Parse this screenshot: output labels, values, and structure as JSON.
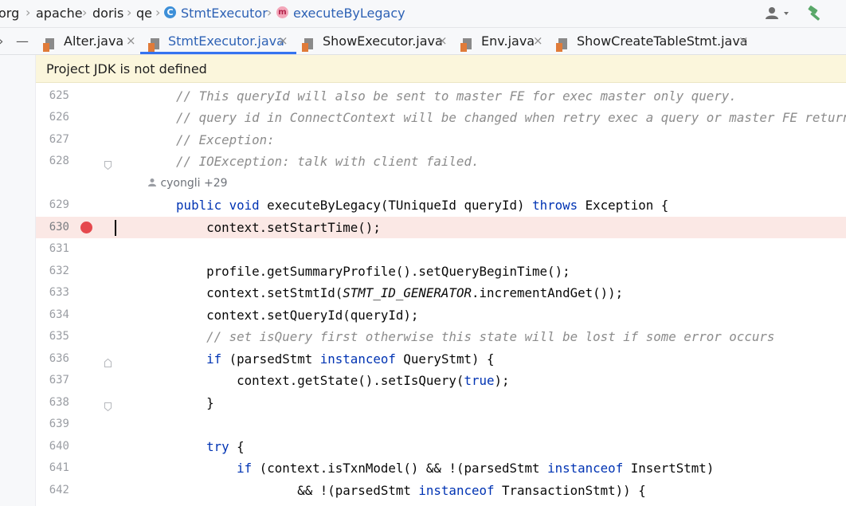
{
  "breadcrumb": {
    "items": [
      "org",
      "apache",
      "doris",
      "qe",
      "StmtExecutor",
      "executeByLegacy"
    ],
    "class_badge": "C",
    "method_badge": "m"
  },
  "toolbar": {
    "user_icon": "user-dropdown-icon",
    "build_icon": "hammer-icon"
  },
  "tabs": [
    {
      "label": "Alter.java",
      "active": false
    },
    {
      "label": "StmtExecutor.java",
      "active": true
    },
    {
      "label": "ShowExecutor.java",
      "active": false
    },
    {
      "label": "Env.java",
      "active": false
    },
    {
      "label": "ShowCreateTableStmt.java",
      "active": false
    }
  ],
  "tab_controls": {
    "minus": "—",
    "close": "×"
  },
  "banner": {
    "text": "Project JDK is not defined"
  },
  "inlay_hint": {
    "author": "cyongli +29"
  },
  "lines": [
    {
      "num": "625",
      "text": "    // This queryId will also be sent to master FE for exec master only query."
    },
    {
      "num": "626",
      "text": "    // query id in ConnectContext will be changed when retry exec a query or master FE return"
    },
    {
      "num": "627",
      "text": "    // Exception:"
    },
    {
      "num": "628",
      "text": "    // IOException: talk with client failed."
    },
    {
      "num": "629",
      "text": "    public void executeByLegacy(TUniqueId queryId) throws Exception {"
    },
    {
      "num": "630",
      "text": "        context.setStartTime();"
    },
    {
      "num": "631",
      "text": ""
    },
    {
      "num": "632",
      "text": "        profile.getSummaryProfile().setQueryBeginTime();"
    },
    {
      "num": "633",
      "text": "        context.setStmtId(STMT_ID_GENERATOR.incrementAndGet());"
    },
    {
      "num": "634",
      "text": "        context.setQueryId(queryId);"
    },
    {
      "num": "635",
      "text": "        // set isQuery first otherwise this state will be lost if some error occurs"
    },
    {
      "num": "636",
      "text": "        if (parsedStmt instanceof QueryStmt) {"
    },
    {
      "num": "637",
      "text": "            context.getState().setIsQuery(true);"
    },
    {
      "num": "638",
      "text": "        }"
    },
    {
      "num": "639",
      "text": ""
    },
    {
      "num": "640",
      "text": "        try {"
    },
    {
      "num": "641",
      "text": "            if (context.isTxnModel() && !(parsedStmt instanceof InsertStmt)"
    },
    {
      "num": "642",
      "text": "                    && !(parsedStmt instanceof TransactionStmt)) {"
    }
  ],
  "breakpoint_line": "630",
  "colors": {
    "keyword": "#0033b3",
    "comment": "#8c8c8c",
    "breakpoint": "#e5484d",
    "highlight_line": "#fbe8e5",
    "banner": "#fbf6dc",
    "active_tab_underline": "#3574f0"
  }
}
